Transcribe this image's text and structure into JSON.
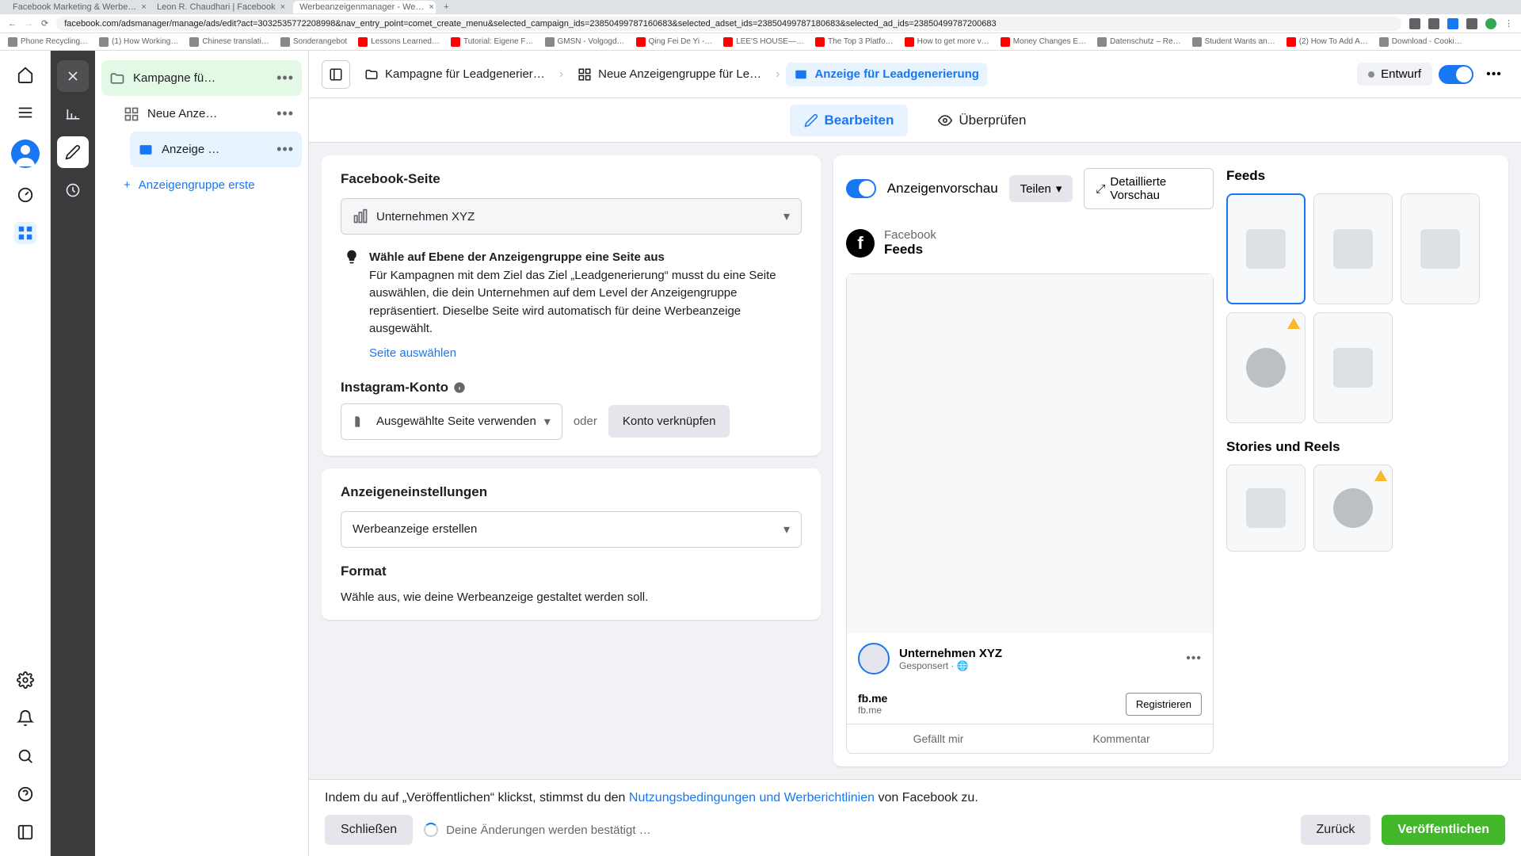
{
  "browser": {
    "tabs": [
      {
        "title": "Facebook Marketing & Werbe…"
      },
      {
        "title": "Leon R. Chaudhari | Facebook"
      },
      {
        "title": "Werbeanzeigenmanager - We…"
      }
    ],
    "url": "facebook.com/adsmanager/manage/ads/edit?act=3032535772208998&nav_entry_point=comet_create_menu&selected_campaign_ids=23850499787160683&selected_adset_ids=23850499787180683&selected_ad_ids=23850499787200683",
    "bookmarks": [
      "Phone Recycling…",
      "(1) How Working…",
      "Chinese translati…",
      "Sonderangebot",
      "Lessons Learned…",
      "Tutorial: Eigene F…",
      "GMSN - Volgogd…",
      "Qing Fei De Yi -…",
      "LEE'S HOUSE—…",
      "The Top 3 Platfo…",
      "How to get more v…",
      "Money Changes E…",
      "Datenschutz – Re…",
      "Student Wants an…",
      "(2) How To Add A…",
      "Download - Cooki…"
    ]
  },
  "tree": {
    "campaign": "Kampagne fü…",
    "adset": "Neue Anze…",
    "ad": "Anzeige …",
    "add": "Anzeigengruppe erste"
  },
  "breadcrumb": {
    "campaign": "Kampagne für Leadgenerier…",
    "adset": "Neue Anzeigengruppe für Le…",
    "ad": "Anzeige für Leadgenerierung",
    "status": "Entwurf"
  },
  "tabs": {
    "edit": "Bearbeiten",
    "review": "Überprüfen"
  },
  "form": {
    "page_label": "Facebook-Seite",
    "page_value": "Unternehmen XYZ",
    "info_title": "Wähle auf Ebene der Anzeigengruppe eine Seite aus",
    "info_body": "Für Kampagnen mit dem Ziel das Ziel „Leadgenerierung“ musst du eine Seite auswählen, die dein Unternehmen auf dem Level der Anzeigengruppe repräsentiert. Dieselbe Seite wird automatisch für deine Werbeanzeige ausgewählt.",
    "info_link": "Seite auswählen",
    "ig_label": "Instagram-Konto",
    "ig_value": "Ausgewählte Seite verwenden",
    "ig_or": "oder",
    "ig_btn": "Konto verknüpfen",
    "settings_title": "Anzeigeneinstellungen",
    "settings_value": "Werbeanzeige erstellen",
    "format_label": "Format",
    "format_sub": "Wähle aus, wie deine Werbeanzeige gestaltet werden soll."
  },
  "preview": {
    "title": "Anzeigenvorschau",
    "share": "Teilen",
    "detail": "Detaillierte Vorschau",
    "platform": "Facebook",
    "placement": "Feeds",
    "mock_name": "Unternehmen XYZ",
    "mock_sponsored": "Gesponsert",
    "mock_url": "fb.me",
    "mock_url2": "fb.me",
    "mock_cta": "Registrieren",
    "mock_like": "Gefällt mir",
    "mock_comment": "Kommentar",
    "sec_feeds": "Feeds",
    "sec_stories": "Stories und Reels"
  },
  "footer": {
    "text_pre": "Indem du auf „Veröffentlichen“ klickst, stimmst du den ",
    "text_link": "Nutzungsbedingungen und Werberichtlinien",
    "text_post": " von Facebook zu.",
    "close": "Schließen",
    "saving": "Deine Änderungen werden bestätigt …",
    "back": "Zurück",
    "publish": "Veröffentlichen"
  }
}
